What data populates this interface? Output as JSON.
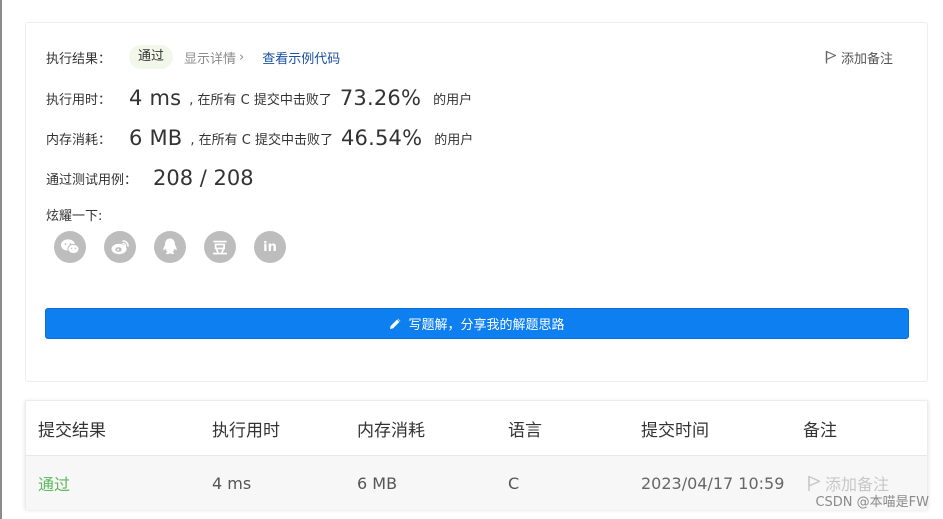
{
  "result": {
    "label": "执行结果：",
    "status": "通过",
    "detail_link": "显示详情",
    "detail_chevron": "›",
    "example_link": "查看示例代码",
    "add_note": "添加备注"
  },
  "runtime": {
    "label": "执行用时：",
    "value": "4 ms",
    "mid_text": ", 在所有 C 提交中击败了",
    "percent": "73.26%",
    "suffix": "的用户"
  },
  "memory": {
    "label": "内存消耗：",
    "value": "6 MB",
    "mid_text": ", 在所有 C 提交中击败了",
    "percent": "46.54%",
    "suffix": "的用户"
  },
  "tests": {
    "label": "通过测试用例：",
    "value": "208 / 208"
  },
  "share": {
    "label": "炫耀一下:",
    "icons": [
      "wechat-icon",
      "weibo-icon",
      "qq-icon",
      "douban-icon",
      "linkedin-icon"
    ],
    "douban_glyph": "豆",
    "linkedin_glyph": "in"
  },
  "write_button": "写题解，分享我的解题思路",
  "table": {
    "headers": [
      "提交结果",
      "执行用时",
      "内存消耗",
      "语言",
      "提交时间",
      "备注"
    ],
    "row": {
      "status": "通过",
      "runtime": "4 ms",
      "memory": "6 MB",
      "language": "C",
      "time": "2023/04/17 10:59",
      "note": "添加备注"
    }
  },
  "watermark": "CSDN @本喵是FW",
  "colors": {
    "accent_blue": "#0d7ff0",
    "pass_green": "#5cb85c",
    "link_blue": "#1a4fa0"
  }
}
